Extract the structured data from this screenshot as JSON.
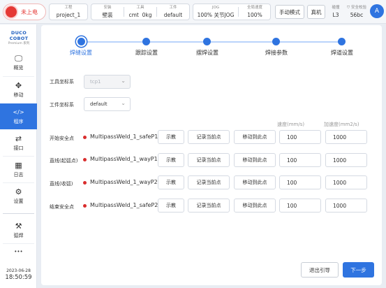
{
  "topbar": {
    "power_label": "未上电",
    "project": {
      "label": "工程",
      "value": "project_1"
    },
    "install": {
      "label": "安装",
      "value": "壁装"
    },
    "tool": {
      "label": "工具",
      "value1": "cmt",
      "value2": "0kg"
    },
    "workpiece": {
      "label": "工件",
      "value": "default"
    },
    "jog": {
      "label": "JOG",
      "value1": "100%",
      "value2": "关节JOG"
    },
    "speed": {
      "label": "全局速度",
      "value": "100%"
    },
    "mode_button": "手动模式",
    "machine_button": "真机",
    "collision": {
      "label": "碰撞",
      "value": "L3"
    },
    "safety": {
      "label": "安全校验",
      "value": "56bc"
    },
    "avatar": "A"
  },
  "sidebar": {
    "logo": "DUCO COBOT",
    "logo_sub": "Premium 系列",
    "items": [
      {
        "label": "概览",
        "icon": "monitor-icon",
        "glyph": "🖵"
      },
      {
        "label": "移动",
        "icon": "move-icon",
        "glyph": "✥"
      },
      {
        "label": "程序",
        "icon": "code-icon",
        "glyph": "</>"
      },
      {
        "label": "接口",
        "icon": "interface-icon",
        "glyph": "⇄"
      },
      {
        "label": "日志",
        "icon": "calendar-icon",
        "glyph": "▦"
      },
      {
        "label": "设置",
        "icon": "gear-icon",
        "glyph": "⚙"
      },
      {
        "label": "弧焊",
        "icon": "welding-icon",
        "glyph": "⚒"
      },
      {
        "label": "",
        "icon": "more-icon",
        "glyph": "•••"
      }
    ],
    "date": "2023-06-28",
    "time": "18:50:59"
  },
  "steps": [
    "焊缝设置",
    "跟踪设置",
    "摆焊设置",
    "焊接参数",
    "焊道设置"
  ],
  "form": {
    "tool_coord_label": "工具坐标系",
    "tool_coord_value": "tcp1",
    "work_coord_label": "工件坐标系",
    "work_coord_value": "default"
  },
  "columns": {
    "speed": "速度(mm/s)",
    "accel": "加速度(mm2/s)"
  },
  "rows": [
    {
      "label": "开始安全点",
      "point": "MultipassWeld_1_safeP1",
      "teach": "示教",
      "record": "记录当前点",
      "move": "移动到此点",
      "speed": "100",
      "accel": "1000"
    },
    {
      "label": "直线(起弧点)",
      "point": "MultipassWeld_1_wayP1",
      "teach": "示教",
      "record": "记录当前点",
      "move": "移动到此点",
      "speed": "100",
      "accel": "1000"
    },
    {
      "label": "直线(收弧)",
      "point": "MultipassWeld_1_wayP2",
      "teach": "示教",
      "record": "记录当前点",
      "move": "移动到此点",
      "speed": "100",
      "accel": "1000"
    },
    {
      "label": "结束安全点",
      "point": "MultipassWeld_1_safeP2",
      "teach": "示教",
      "record": "记录当前点",
      "move": "移动到此点",
      "speed": "100",
      "accel": "1000"
    }
  ],
  "footer": {
    "exit": "退出引导",
    "next": "下一步"
  }
}
